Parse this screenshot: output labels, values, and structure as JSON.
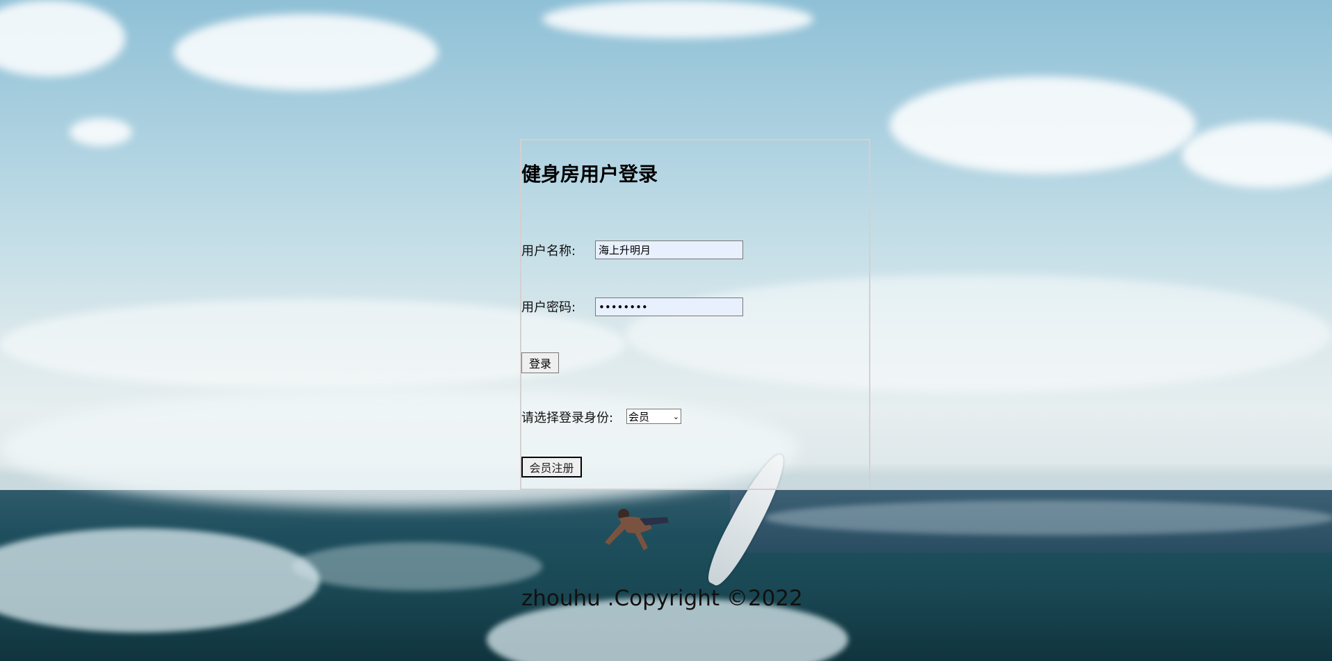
{
  "login": {
    "title": "健身房用户登录",
    "username_label": "用户名称:",
    "username_value": "海上升明月",
    "password_label": "用户密码:",
    "password_value": "12345678",
    "login_button": "登录",
    "role_label": "请选择登录身份:",
    "role_selected": "会员",
    "register_button": "会员注册"
  },
  "footer": {
    "text": "zhouhu .Copyright ©2022"
  },
  "icons": {
    "select_arrow": "chevron-down-icon"
  }
}
